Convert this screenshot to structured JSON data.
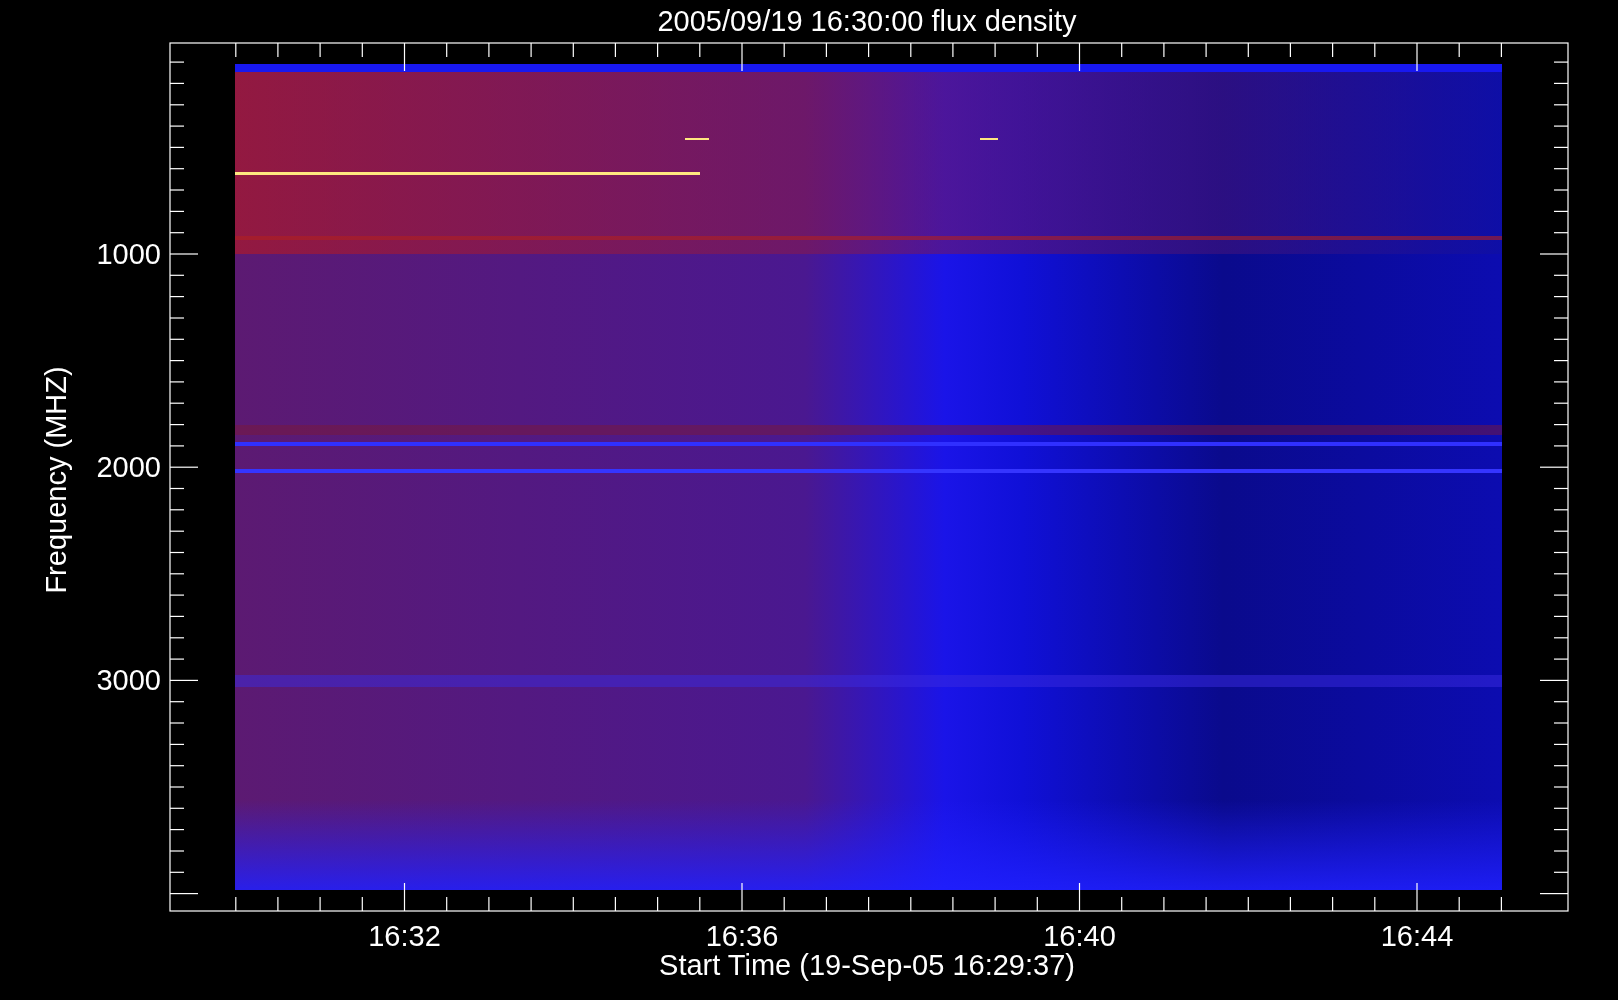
{
  "title": "2005/09/19 16:30:00 flux density",
  "x_axis": {
    "label": "Start Time (19-Sep-05 16:29:37)",
    "tick_labels": [
      "16:32",
      "16:36",
      "16:40",
      "16:44"
    ]
  },
  "y_axis": {
    "label": "Frequency (MHZ)",
    "tick_labels": [
      "1000",
      "2000",
      "3000"
    ]
  }
}
